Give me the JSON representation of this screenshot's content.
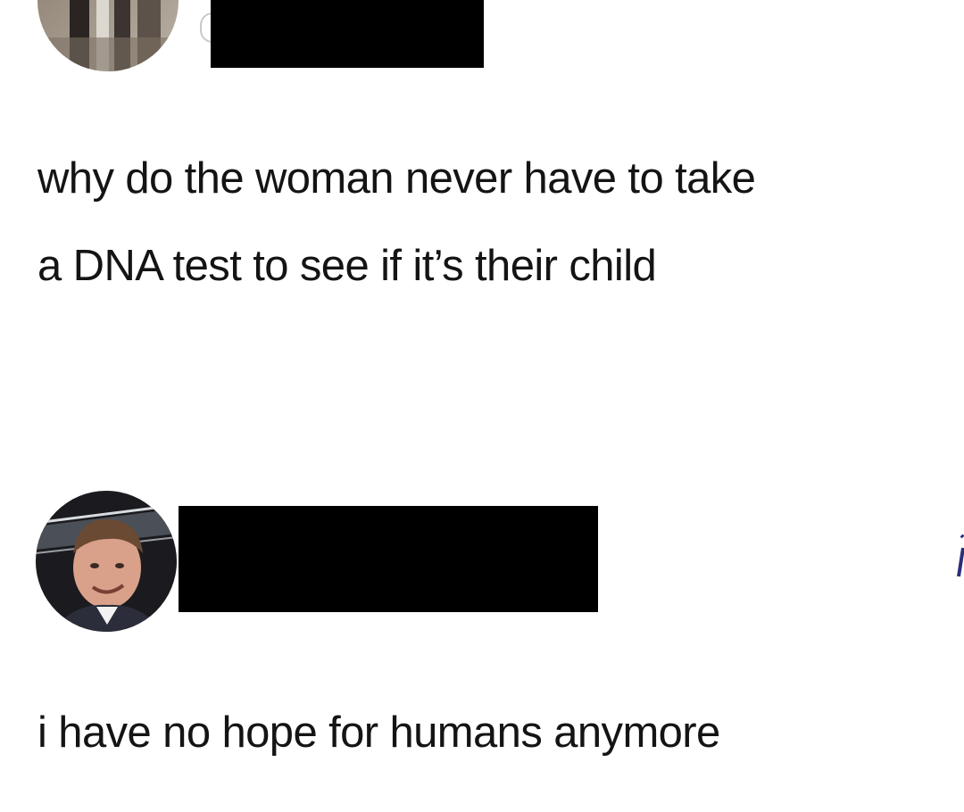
{
  "posts": [
    {
      "avatar_icon": "profile-photo-icon",
      "text_line1": "why do the woman never have to take",
      "text_line2": "a DNA test to see if it’s their child"
    },
    {
      "avatar_icon": "profile-photo-icon",
      "text": "i have no hope for humans anymore"
    }
  ],
  "colors": {
    "background": "#ffffff",
    "text": "#141414",
    "redaction": "#000000"
  }
}
